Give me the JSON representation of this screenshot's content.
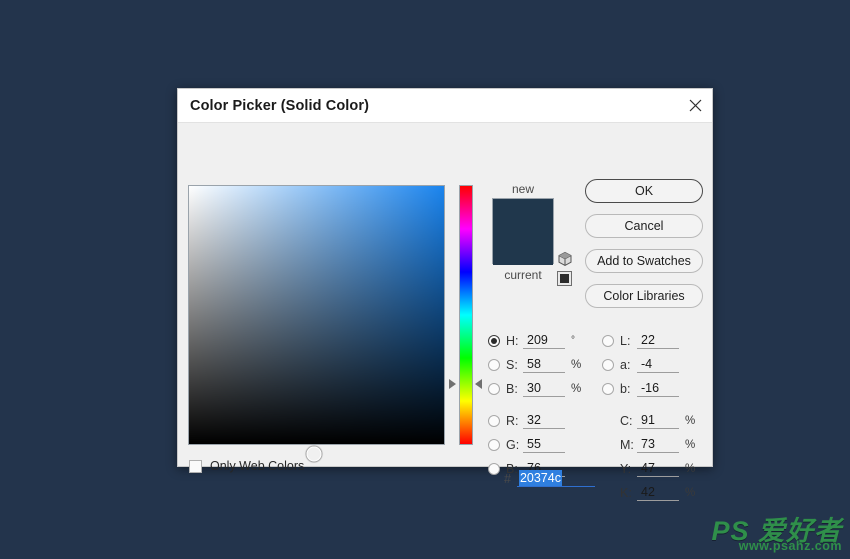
{
  "desktop": {
    "background_color": "#23344c"
  },
  "dialog": {
    "title": "Color Picker (Solid Color)",
    "close_icon": "close-icon",
    "background_color": "#f0f0f0",
    "titlebar_color": "#ffffff"
  },
  "color_field": {
    "cursor_x_pct": 49,
    "cursor_y_pct": 104,
    "top_right_color": "#1a84ee"
  },
  "hue_slider": {
    "marker_y_px": 201,
    "marker_icon": "triangle-marker-icon"
  },
  "preview": {
    "new_label": "new",
    "current_label": "current",
    "new_color": "#20374c",
    "current_color": "#20374c",
    "gamut_warning_icon": "cube-icon",
    "websafe_warning_icon": "square-icon"
  },
  "buttons": {
    "ok": "OK",
    "cancel": "Cancel",
    "add_to_swatches": "Add to Swatches",
    "color_libraries": "Color Libraries"
  },
  "options": {
    "only_web_colors_label": "Only Web Colors",
    "only_web_colors_checked": false
  },
  "fields": {
    "hsb": [
      {
        "key": "H",
        "label": "H:",
        "value": "209",
        "unit": "°",
        "selected": true
      },
      {
        "key": "S",
        "label": "S:",
        "value": "58",
        "unit": "%",
        "selected": false
      },
      {
        "key": "B",
        "label": "B:",
        "value": "30",
        "unit": "%",
        "selected": false
      }
    ],
    "rgb": [
      {
        "key": "R",
        "label": "R:",
        "value": "32",
        "unit": "",
        "selected": false
      },
      {
        "key": "G",
        "label": "G:",
        "value": "55",
        "unit": "",
        "selected": false
      },
      {
        "key": "B",
        "label": "B:",
        "value": "76",
        "unit": "",
        "selected": false
      }
    ],
    "lab": [
      {
        "key": "L",
        "label": "L:",
        "value": "22",
        "unit": "",
        "selected": false
      },
      {
        "key": "a",
        "label": "a:",
        "value": "-4",
        "unit": "",
        "selected": false
      },
      {
        "key": "b",
        "label": "b:",
        "value": "-16",
        "unit": "",
        "selected": false
      }
    ],
    "cmyk": [
      {
        "key": "C",
        "label": "C:",
        "value": "91",
        "unit": "%"
      },
      {
        "key": "M",
        "label": "M:",
        "value": "73",
        "unit": "%"
      },
      {
        "key": "Y",
        "label": "Y:",
        "value": "47",
        "unit": "%"
      },
      {
        "key": "K",
        "label": "K:",
        "value": "42",
        "unit": "%"
      }
    ],
    "hex": {
      "hash": "#",
      "value": "20374c",
      "selected": true
    }
  },
  "watermark": {
    "brand": "PS 爱好者",
    "url": "www.psahz.com",
    "color": "#2f8f4a"
  }
}
